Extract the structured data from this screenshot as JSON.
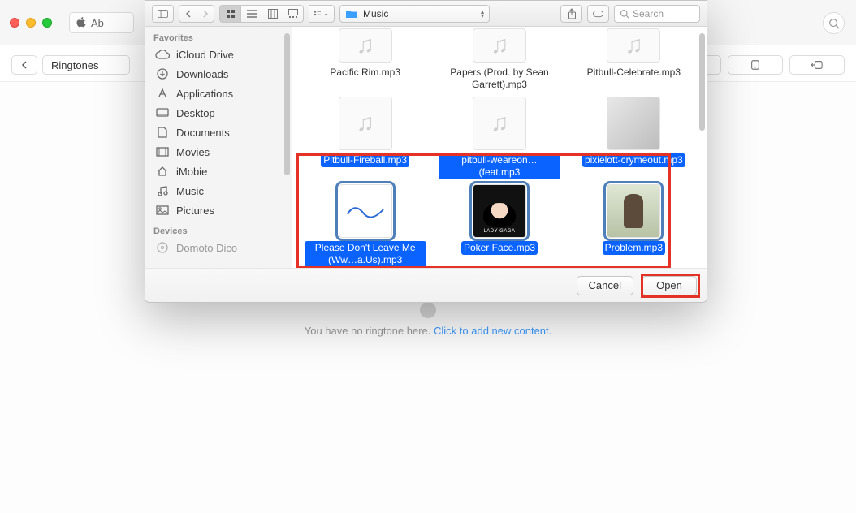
{
  "bg": {
    "url_hint": "Ab",
    "breadcrumb": "Ringtones",
    "empty_text": "You have no ringtone here. ",
    "empty_link": "Click to add new content."
  },
  "dialog": {
    "toolbar": {
      "folder": "Music",
      "search_placeholder": "Search"
    },
    "sidebar": {
      "groups": [
        {
          "label": "Favorites",
          "items": [
            {
              "icon": "cloud",
              "label": "iCloud Drive"
            },
            {
              "icon": "download",
              "label": "Downloads"
            },
            {
              "icon": "apps",
              "label": "Applications"
            },
            {
              "icon": "desktop",
              "label": "Desktop"
            },
            {
              "icon": "doc",
              "label": "Documents"
            },
            {
              "icon": "movie",
              "label": "Movies"
            },
            {
              "icon": "house",
              "label": "iMobie"
            },
            {
              "icon": "music",
              "label": "Music"
            },
            {
              "icon": "picture",
              "label": "Pictures"
            }
          ]
        },
        {
          "label": "Devices",
          "items": [
            {
              "icon": "disc",
              "label": "Domoto Dico"
            }
          ]
        }
      ]
    },
    "files": [
      {
        "name": "Pacific Rim.mp3",
        "thumb": "music",
        "selected_name": false,
        "selected_thumb": false,
        "partial": "name-only"
      },
      {
        "name": "Papers (Prod. by Sean Garrett).mp3",
        "thumb": "music",
        "selected_name": false,
        "selected_thumb": false,
        "partial": "name-only"
      },
      {
        "name": "Pitbull-Celebrate.mp3",
        "thumb": "music",
        "selected_name": false,
        "selected_thumb": false,
        "partial": "name-only"
      },
      {
        "name": "Pitbull-Fireball.mp3",
        "thumb": "music",
        "selected_name": true,
        "selected_thumb": false
      },
      {
        "name": "pitbull-weareon…(feat.mp3",
        "thumb": "music",
        "selected_name": true,
        "selected_thumb": false
      },
      {
        "name": "pixielott-crymeout.mp3",
        "thumb": "cover1",
        "selected_name": true,
        "selected_thumb": false
      },
      {
        "name": "Please Don't Leave Me (Ww…a.Us).mp3",
        "thumb": "cover2",
        "selected_name": true,
        "selected_thumb": true
      },
      {
        "name": "Poker Face.mp3",
        "thumb": "cover3",
        "selected_name": true,
        "selected_thumb": true
      },
      {
        "name": "Problem.mp3",
        "thumb": "cover4",
        "selected_name": true,
        "selected_thumb": true
      }
    ],
    "footer": {
      "cancel": "Cancel",
      "open": "Open"
    }
  },
  "cover3_caption": "LADY GAGA"
}
